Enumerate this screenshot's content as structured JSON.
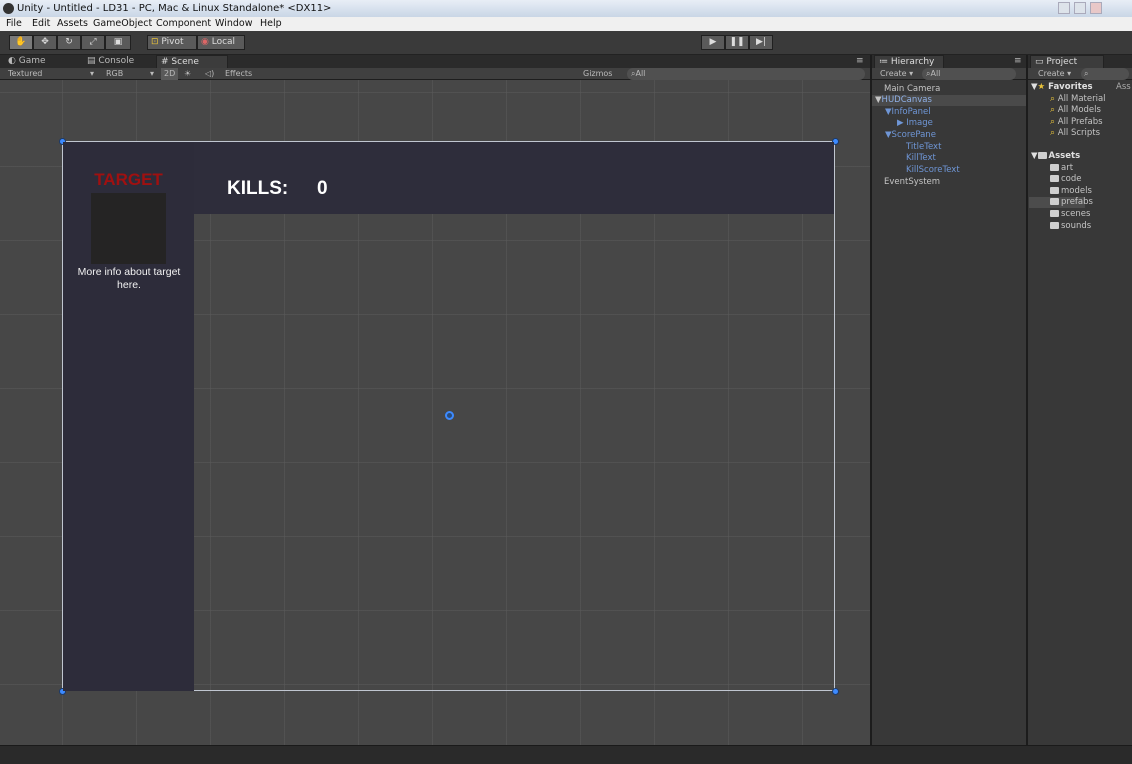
{
  "window": {
    "title": "Unity - Untitled - LD31 - PC, Mac & Linux Standalone* <DX11>"
  },
  "menu": [
    "File",
    "Edit",
    "Assets",
    "GameObject",
    "Component",
    "Window",
    "Help"
  ],
  "toolbar": {
    "tools": [
      "hand-tool-icon",
      "move-tool-icon",
      "rotate-tool-icon",
      "scale-tool-icon",
      "rect-tool-icon"
    ],
    "pivot_label": "Pivot",
    "local_label": "Local"
  },
  "scene": {
    "tabs": [
      "Game",
      "Console",
      "Scene"
    ],
    "active_tab": "Scene",
    "controls": {
      "shading": "Textured",
      "render_mode": "RGB",
      "mode_2d": "2D",
      "effects": "Effects",
      "gizmos": "Gizmos",
      "search_placeholder": "All"
    }
  },
  "hud": {
    "target_title": "TARGET",
    "target_info": "More info about target here.",
    "kills_label": "KILLS:",
    "kills_value": "0"
  },
  "hierarchy": {
    "title": "Hierarchy",
    "create_label": "Create",
    "search_placeholder": "All",
    "items": [
      {
        "label": "Main Camera"
      },
      {
        "label": "HUDCanvas"
      },
      {
        "label": "InfoPanel"
      },
      {
        "label": "Image"
      },
      {
        "label": "ScorePane"
      },
      {
        "label": "TitleText"
      },
      {
        "label": "KillText"
      },
      {
        "label": "KillScoreText"
      },
      {
        "label": "EventSystem"
      }
    ]
  },
  "project": {
    "title": "Project",
    "create_label": "Create",
    "favorites_label": "Favorites",
    "favorites": [
      "All Material",
      "All Models",
      "All Prefabs",
      "All Scripts"
    ],
    "assets_label": "Assets",
    "folders": [
      "art",
      "code",
      "models",
      "prefabs",
      "scenes",
      "sounds"
    ],
    "truncated_right": "Ass"
  },
  "colors": {
    "target_red": "#a01010",
    "panel_dark": "#2d2c3a",
    "selection_blue": "#3d8aff",
    "hierarchy_link": "#6f96d6",
    "viewport_bg": "#474747"
  }
}
